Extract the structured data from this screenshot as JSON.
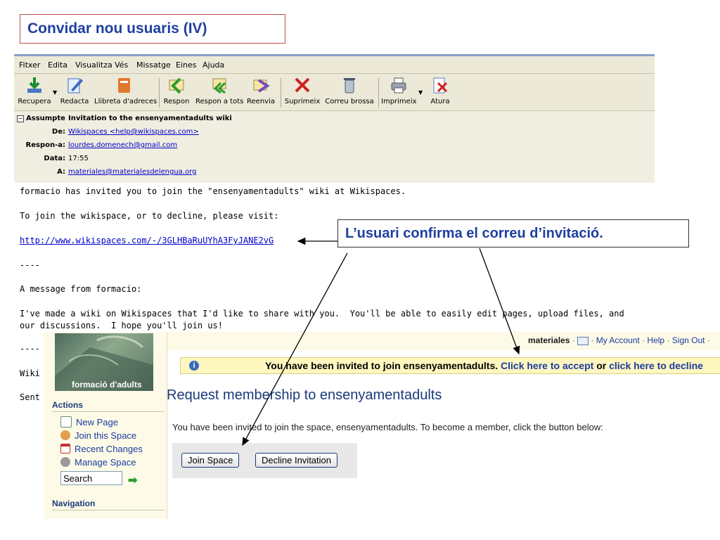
{
  "slide": {
    "title": "Convidar nou usuaris (IV)"
  },
  "email_client": {
    "menu": [
      "Fitxer",
      "Edita",
      "Visualitza",
      "Vés",
      "Missatge",
      "Eines",
      "Ajuda"
    ],
    "toolbar": {
      "recupera": "Recupera",
      "redacta": "Redacta",
      "llibreta": "Llibreta d'adreces",
      "respon": "Respon",
      "respon_tots": "Respon a tots",
      "reenvia": "Reenvia",
      "suprimeix": "Suprimeix",
      "correu_brossa": "Correu brossa",
      "imprimeix": "Imprimeix",
      "atura": "Atura"
    },
    "headers": {
      "subject_label": "Assumpte",
      "subject": "Invitation to the ensenyamentadults wiki",
      "from_label": "De:",
      "from": "Wikispaces <help@wikispaces.com>",
      "reply_to_label": "Respon-a:",
      "reply_to": "lourdes.domenech@gmail.com",
      "date_label": "Data:",
      "date": "17:55",
      "to_label": "A:",
      "to": "materiales@materialesdelengua.org"
    }
  },
  "email_body": {
    "line1": "formacio has invited you to join the \"ensenyamentadults\" wiki at Wikispaces.",
    "line2": "To join the wikispace, or to decline, please visit:",
    "link": "http://www.wikispaces.com/-/3GLHBaRuUYhA3FyJANE2vG",
    "separator": "----",
    "line3": "A message from formacio:",
    "line4": "I've made a wiki on Wikispaces that I'd like to share with you.  You'll be able to easily edit pages, upload files, and",
    "line5": "our discussions.  I hope you'll join us!",
    "separator2": "----",
    "line6_partial": "Wiki",
    "line7_partial": "Sent"
  },
  "annotation": "L’usuari confirma el correu d’invitació.",
  "wiki": {
    "logo_caption": "formació d'adults",
    "topbar": {
      "user": "materiales",
      "sep1": " · ",
      "sep2": " · ",
      "my_account": "My Account",
      "help": "Help",
      "sign_out": "Sign Out",
      "dot": " · "
    },
    "notice": {
      "text": "You have been invited to join ensenyamentadults.",
      "accept": "Click here to accept",
      "or": "or",
      "decline": "click here to decline"
    },
    "sidebar": {
      "actions_heading": "Actions",
      "items": [
        "New Page",
        "Join this Space",
        "Recent Changes",
        "Manage Space"
      ],
      "search_value": "Search",
      "navigation_heading": "Navigation"
    },
    "request_title": "Request membership to ensenyamentadults",
    "request_desc": "You have been invited to join the space, ensenyamentadults. To become a member, click the button below:",
    "buttons": {
      "join": "Join Space",
      "decline": "Decline Invitation"
    }
  },
  "colors": {
    "title_blue": "#1f3fa0",
    "link_blue": "#0000c8",
    "wiki_link": "#1a3aa0"
  }
}
